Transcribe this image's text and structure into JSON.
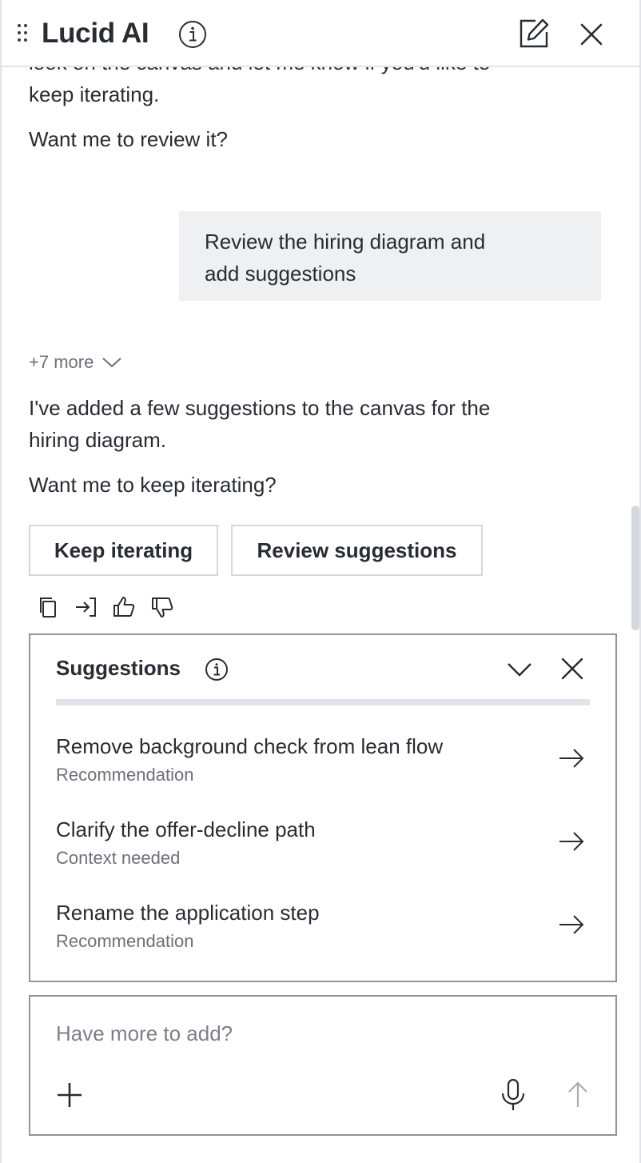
{
  "header": {
    "title": "Lucid AI",
    "icons": [
      "drag-handle-icon",
      "info-icon",
      "edit-icon",
      "close-icon"
    ]
  },
  "conversation": {
    "cut_line": "look on the canvas and let me know if you'd like to",
    "line_keep": "keep iterating.",
    "question_review": "Want me to review it?",
    "user_message_line1": "Review the hiring diagram and",
    "user_message_line2": "add suggestions",
    "more_toggle": "+7 more",
    "response_line1": "I've added a few suggestions to the canvas for the",
    "response_line2": "hiring diagram.",
    "question_iterate": "Want me to keep iterating?"
  },
  "quick_replies": {
    "keep": "Keep iterating",
    "review": "Review suggestions"
  },
  "message_actions": [
    "copy-icon",
    "insert-icon",
    "thumbs-up-icon",
    "thumbs-down-icon"
  ],
  "suggestions": {
    "title": "Suggestions",
    "items": [
      {
        "title": "Remove background check from lean flow",
        "type": "Recommendation"
      },
      {
        "title": "Clarify the offer-decline path",
        "type": "Context needed"
      },
      {
        "title": "Rename the application step",
        "type": "Recommendation"
      }
    ]
  },
  "composer": {
    "placeholder": "Have more to add?",
    "value": ""
  },
  "colors": {
    "text": "#282c33",
    "muted": "#6b7079",
    "bubble": "#eef0f2",
    "border": "#8f949b",
    "button_border": "#d4d8dd"
  }
}
